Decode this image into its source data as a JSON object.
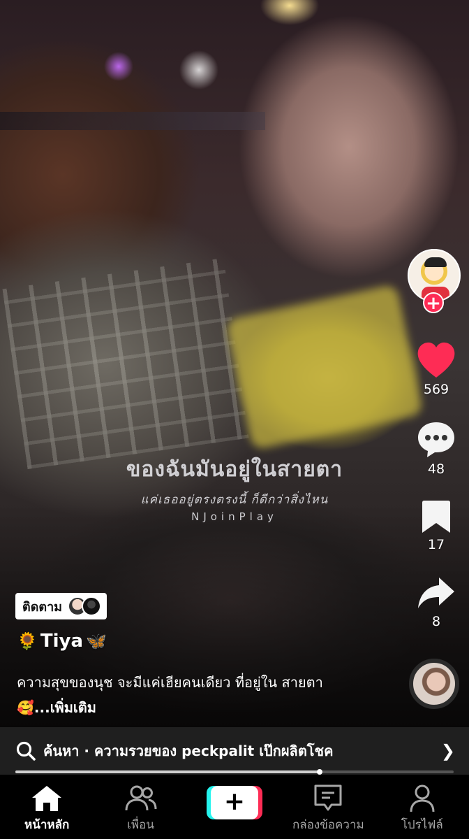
{
  "video": {
    "overlay_line1": "ของฉันมันอยู่ในสายตา",
    "overlay_line2": "แค่เธออยู่ตรงตรงนี้ ก็ดีกว่าสิ่งไหน",
    "overlay_line3": "NJoinPlay"
  },
  "actions": {
    "likes": "569",
    "comments": "48",
    "saves": "17",
    "shares": "8"
  },
  "post": {
    "follow_label": "ติดตาม",
    "username": "Tiya",
    "username_prefix_emoji": "🌻",
    "username_suffix_emoji": "🦋",
    "description": "ความสุขของนุช จะมีแค่เฮียคนเดียว ที่อยู่ใน สายตา 🥰",
    "more_label": "...เพิ่มเติม"
  },
  "search": {
    "text": "ค้นหา · ความรวยของ peckpalit เป๊กผลิตโชค"
  },
  "progress": {
    "fraction": 0.695
  },
  "nav": {
    "home": "หน้าหลัก",
    "friends": "เพื่อน",
    "inbox": "กล่องข้อความ",
    "profile": "โปรไฟล์"
  },
  "colors": {
    "like": "#fe2c55",
    "create_cyan": "#25f4ee",
    "create_red": "#fe2c55"
  }
}
